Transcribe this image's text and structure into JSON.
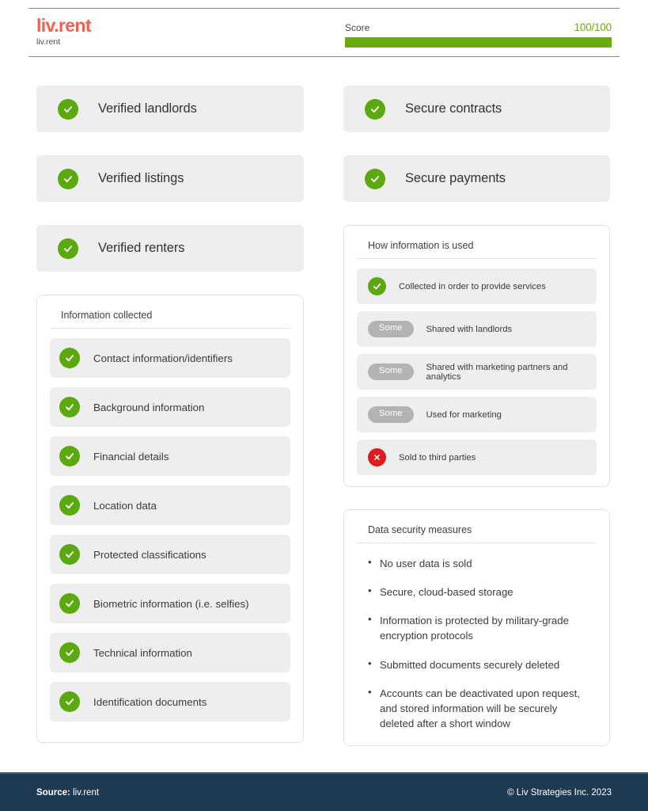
{
  "header": {
    "brand": "liv.rent",
    "brand_sub": "liv.rent",
    "score_label": "Score",
    "score_value": "100/100",
    "score_percent": 100,
    "accent_green": "#6cab10",
    "brand_color": "#f4604f"
  },
  "left_cards": [
    {
      "icon": "check-circle-icon",
      "label": "Verified landlords"
    },
    {
      "icon": "check-circle-icon",
      "label": "Verified listings"
    },
    {
      "icon": "check-circle-icon",
      "label": "Verified renters"
    }
  ],
  "right_cards": [
    {
      "icon": "check-circle-icon",
      "label": "Secure contracts"
    },
    {
      "icon": "check-circle-icon",
      "label": "Secure payments"
    }
  ],
  "information_collected": {
    "title": "Information collected",
    "items": [
      {
        "icon": "check-circle-icon",
        "label": "Contact information/identifiers"
      },
      {
        "icon": "check-circle-icon",
        "label": "Background information"
      },
      {
        "icon": "check-circle-icon",
        "label": "Financial details"
      },
      {
        "icon": "check-circle-icon",
        "label": "Location data"
      },
      {
        "icon": "check-circle-icon",
        "label": "Protected classifications"
      },
      {
        "icon": "check-circle-icon",
        "label": "Biometric information (i.e. selfies)"
      },
      {
        "icon": "check-circle-icon",
        "label": "Technical information"
      },
      {
        "icon": "check-circle-icon",
        "label": "Identification documents"
      }
    ]
  },
  "how_information_is_used": {
    "title": "How information is used",
    "items": [
      {
        "icon": "check-circle-icon",
        "badge": null,
        "label": "Collected in order to provide services"
      },
      {
        "icon": "some-badge",
        "badge": "Some",
        "label": "Shared with landlords"
      },
      {
        "icon": "some-badge",
        "badge": "Some",
        "label": "Shared with marketing partners and analytics"
      },
      {
        "icon": "some-badge",
        "badge": "Some",
        "label": "Used for marketing"
      },
      {
        "icon": "cross-circle-icon",
        "badge": null,
        "label": "Sold to third parties"
      }
    ]
  },
  "data_security_measures": {
    "title": "Data security measures",
    "bullets": [
      "No user data is sold",
      "Secure, cloud-based storage",
      "Information is protected by military-grade encryption protocols",
      "Submitted documents securely deleted",
      "Accounts can be deactivated upon request, and stored information will be securely deleted after a short window"
    ]
  },
  "footer": {
    "source_label": "Source:",
    "source_value": "liv.rent",
    "copyright": "© Liv Strategies Inc. 2023"
  }
}
